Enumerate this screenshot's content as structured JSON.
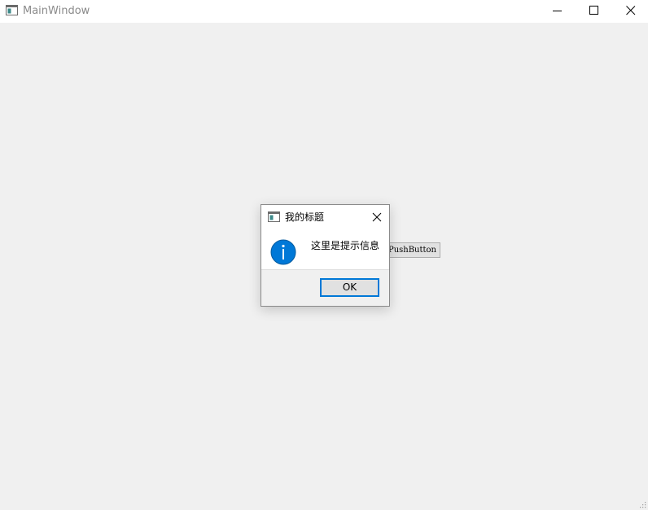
{
  "window": {
    "title": "MainWindow"
  },
  "main": {
    "push_button_label": "PushButton"
  },
  "dialog": {
    "title": "我的标题",
    "message": "这里是提示信息",
    "ok_label": "OK",
    "icon": "info-icon"
  },
  "colors": {
    "accent": "#0078d7",
    "info_icon": "#0078d7",
    "background": "#f0f0f0"
  }
}
